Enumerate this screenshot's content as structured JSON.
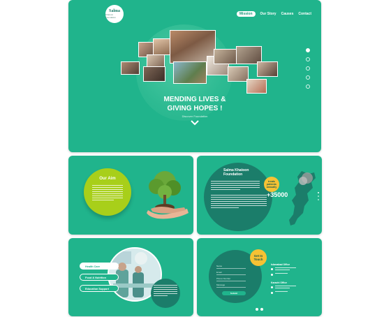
{
  "hero": {
    "logo_title": "Salma",
    "logo_subtitle": "Khatoon Foundation",
    "nav": [
      "Mission",
      "Our Story",
      "Causes",
      "Contact"
    ],
    "headline_line1": "MENDING LIVES &",
    "headline_line2": "GIVING HOPES !",
    "subheadline": "Discover Foundation",
    "slide_count": 5,
    "active_slide": 1
  },
  "aim": {
    "title": "Our Aim"
  },
  "foundation": {
    "title_line1": "Salma Khatoon",
    "title_line2": "Foundation",
    "badge_line1": "treats",
    "badge_line2": "patients",
    "badge_line3": "annually",
    "stat": "+35000"
  },
  "services": {
    "items": [
      "Health Care",
      "Food & Nutrition",
      "Education Support"
    ],
    "selected_index": 0
  },
  "contact": {
    "badge_line1": "Get In",
    "badge_line2": "Touch",
    "fields": [
      "Name",
      "Email",
      "Phone Number",
      "Message"
    ],
    "submit_label": "Submit",
    "office1_title": "Islamabad Office",
    "office2_title": "Karachi Office"
  },
  "colors": {
    "primary": "#20b48c",
    "dark": "#1b7d6a",
    "lime": "#a8cf1a",
    "accent_yellow": "#f6c234"
  }
}
